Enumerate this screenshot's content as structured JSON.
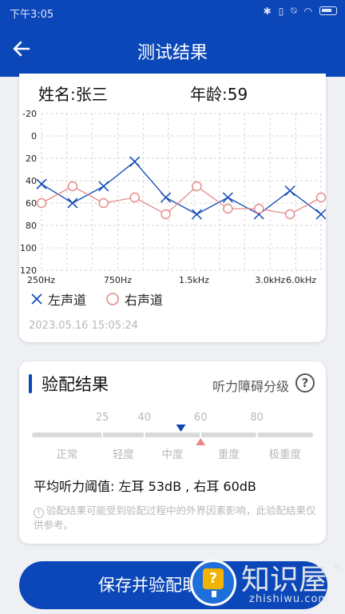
{
  "status_bar": {
    "time": "下午3:05",
    "icons": [
      "bluetooth-icon",
      "vibrate-icon",
      "mute-icon",
      "wifi-icon",
      "battery-icon"
    ]
  },
  "header": {
    "title": "测试结果",
    "back_icon": "arrow-left-icon"
  },
  "patient": {
    "name": "姓名:张三",
    "age": "年龄:59"
  },
  "chart_data": {
    "type": "line",
    "y_ticks": [
      -20,
      0,
      20,
      40,
      60,
      80,
      100,
      120
    ],
    "ylim": [
      -20,
      120
    ],
    "y_inverted": true,
    "x_tick_labels": [
      "250Hz",
      "750Hz",
      "1.5kHz",
      "3.0kHz",
      "6.0kHz"
    ],
    "x_points": 12,
    "grid": true,
    "series": [
      {
        "name": "左声道",
        "marker": "x",
        "color": "#0b47b8",
        "values": [
          43,
          60,
          45,
          23,
          55,
          70,
          55,
          70,
          49,
          70
        ]
      },
      {
        "name": "右声道",
        "marker": "circle",
        "color": "#e48a88",
        "values": [
          60,
          45,
          60,
          55,
          70,
          45,
          65,
          65,
          70,
          55
        ]
      }
    ]
  },
  "legend": {
    "left": "左声道",
    "right": "右声道"
  },
  "timestamp": "2023.05.16 15:05:24",
  "fitting": {
    "title": "验配结果",
    "link": "听力障碍分级",
    "help_icon": "question-circle-icon",
    "scale_numbers": [
      "25",
      "40",
      "60",
      "80"
    ],
    "scale_labels": [
      "正常",
      "轻度",
      "中度",
      "重度",
      "极重度"
    ],
    "marker_left_value": 53,
    "marker_right_value": 60,
    "average": "平均听力阈值:  左耳 53dB , 右耳 60dB",
    "note": "验配结果可能受到验配过程中的外界因素影响，此验配结果仅供参考。",
    "note_icon": "exclamation-circle-icon"
  },
  "save_button": "保存并验配助听器",
  "watermark": {
    "text": "知识屋",
    "url": "zhishiwu.com",
    "reg": "®"
  },
  "colors": {
    "primary": "#0b47b8",
    "left": "#0b47b8",
    "right": "#e48a88"
  }
}
